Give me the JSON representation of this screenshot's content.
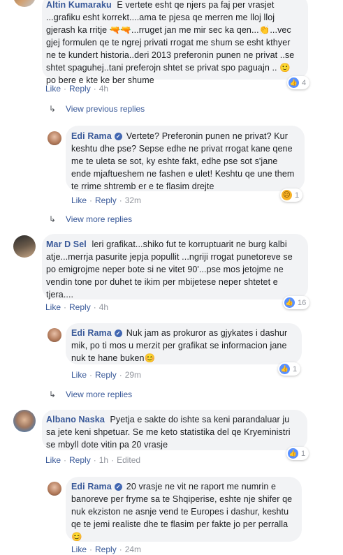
{
  "comments": [
    {
      "author": "Altin Kumaraku",
      "text": "E vertete esht qe njers pa faj per vrasjet ...grafiku esht korrekt....ama te pjesa qe merren me lloj lloj gjerash ka rritje 🔫🔫...rruget jan me mir sec ka qen...👏...vec gjej formulen qe te ngrej privati rrogat me shum se esht kthyer ne te kundert historia..deri 2013 preferonin punen ne privat ..se shtet spaguhej..tani preferojn shtet se privat spo paguajn .. 🙂 po bere e kte ke ber shume",
      "like": "Like",
      "reply": "Reply",
      "time": "4h",
      "reaction_count": "4"
    },
    {
      "view_link": "View previous replies"
    },
    {
      "author": "Edi Rama",
      "text": "Vertete? Preferonin punen ne privat? Kur keshtu dhe pse? Sepse edhe ne privat rrogat kane qene me te uleta se sot, ky eshte fakt, edhe pse sot s'jane ende mjaftueshem ne fashen e ulet! Keshtu qe une them te rrime shtremb er e te flasim drejte",
      "like": "Like",
      "reply": "Reply",
      "time": "32m",
      "reaction_count": "1"
    },
    {
      "view_link": "View more replies"
    },
    {
      "author": "Mar D Sel",
      "text": "leri grafikat...shiko fut te korruptuarit ne burg kalbi atje...merrja pasurite jepja popullit ...ngriji rrogat punetoreve se po emigrojme neper bote si ne vitet 90'...pse mos jetojme ne vendin tone por duhet te ikim per mbijetese neper shtetet e tjera....",
      "like": "Like",
      "reply": "Reply",
      "time": "4h",
      "reaction_count": "16"
    },
    {
      "author": "Edi Rama",
      "text": "Nuk jam as prokuror as gjykates i dashur mik, po ti mos u merzit per grafikat se informacion jane nuk te hane buken😊",
      "like": "Like",
      "reply": "Reply",
      "time": "29m",
      "reaction_count": "1"
    },
    {
      "view_link": "View more replies"
    },
    {
      "author": "Albano Naska",
      "text": "Pyetja e sakte do ishte sa keni parandaluar ju sa jete keni shpetuar. Se me keto statistika del qe Kryeministri se mbyll dote vitin pa 20 vrasje",
      "like": "Like",
      "reply": "Reply",
      "time": "1h",
      "edited": "Edited",
      "reaction_count": "1"
    },
    {
      "author": "Edi Rama",
      "text": "20 vrasje ne vit ne raport me numrin e banoreve per fryme sa te Shqiperise, eshte nje shifer qe nuk ekziston ne asnje vend te Europes i dashur, keshtu qe te jemi realiste dhe te flasim per fakte jo per perralla😊",
      "like": "Like",
      "reply": "Reply",
      "time": "24m"
    }
  ],
  "colors": {
    "link": "#385898",
    "meta": "#90949c",
    "bubble": "#f2f3f5",
    "like_blue": "#5890ff",
    "sad_yellow": "#f7b125"
  },
  "icons": {
    "reply_arrow": "reply-arrow-icon",
    "verified": "verified-badge-icon",
    "like": "like-reaction-icon",
    "sad": "sad-reaction-icon"
  }
}
